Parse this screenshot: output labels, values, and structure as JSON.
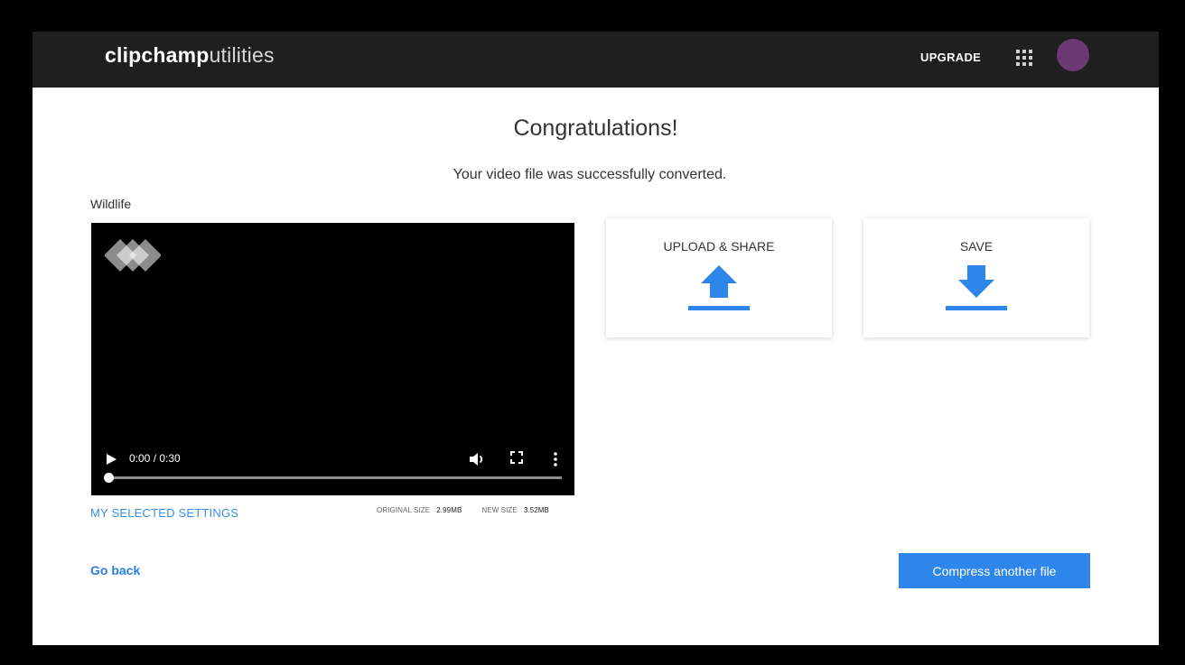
{
  "header": {
    "logo_brand": "clipchamp",
    "logo_sub": "utilities",
    "upgrade_label": "UPGRADE"
  },
  "main": {
    "title": "Congratulations!",
    "subtitle": "Your video file was successfully converted.",
    "file_name": "Wildlife"
  },
  "player": {
    "time": "0:00 / 0:30",
    "progress_fraction": 0
  },
  "settings": {
    "link_label": "MY SELECTED SETTINGS",
    "original_size_label": "ORIGINAL SIZE",
    "original_size_value": "2.99MB",
    "new_size_label": "NEW SIZE",
    "new_size_value": "3.52MB"
  },
  "actions": {
    "upload_label": "UPLOAD & SHARE",
    "save_label": "SAVE",
    "go_back_label": "Go back",
    "compress_label": "Compress another file"
  },
  "colors": {
    "accent": "#2f86ea",
    "link": "#3a8ee6",
    "topbar": "#1f1f1f",
    "avatar": "#6c3a72"
  },
  "icons": {
    "apps": "grid-icon",
    "upload": "upload-arrow-icon",
    "save": "download-arrow-icon",
    "play": "play-icon",
    "volume": "volume-icon",
    "fullscreen": "fullscreen-icon",
    "more": "more-vertical-icon"
  }
}
